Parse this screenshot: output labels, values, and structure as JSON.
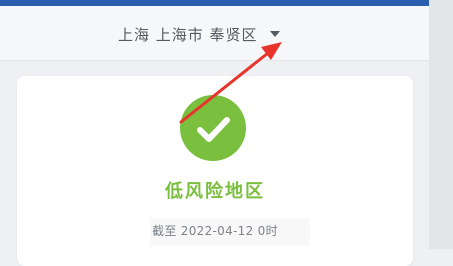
{
  "header": {
    "region_text": "上海 上海市 奉贤区",
    "dropdown_icon": "caret-down-icon"
  },
  "status_card": {
    "icon": "checkmark-icon",
    "risk_level": "低风险地区",
    "as_of": "截至 2022-04-12 0时"
  },
  "annotation": {
    "icon": "red-arrow",
    "color": "#e8342a"
  },
  "colors": {
    "brand_blue": "#2a5fae",
    "low_risk_green": "#7bbf3e"
  }
}
